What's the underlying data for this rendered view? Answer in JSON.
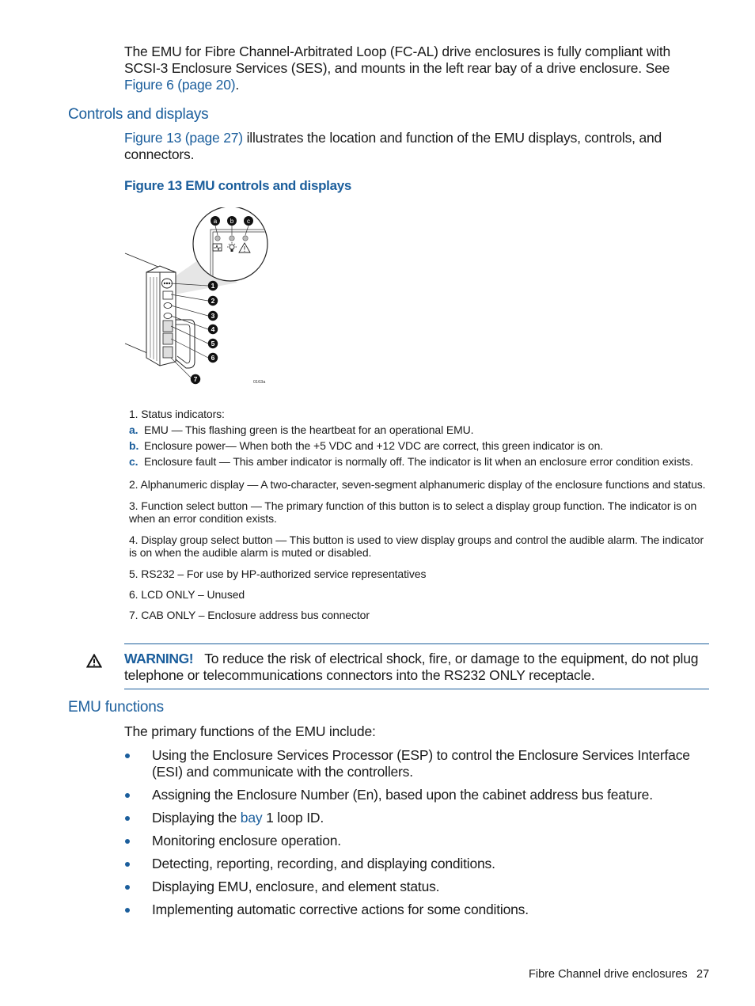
{
  "intro": {
    "text_before_link": "The EMU for Fibre Channel-Arbitrated Loop (FC-AL) drive enclosures is fully compliant with SCSI-3 Enclosure Services (SES), and mounts in the left rear bay of a drive enclosure. See ",
    "link": "Figure 6 (page 20)",
    "text_after_link": "."
  },
  "controls_section": {
    "heading": "Controls and displays",
    "para_link": "Figure 13 (page 27)",
    "para_text": " illustrates the location and function of the EMU displays, controls, and connectors.",
    "figure_title": "Figure 13 EMU controls and displays",
    "figure": {
      "inset_labels": [
        "a",
        "b",
        "c"
      ],
      "inset_icons": [
        "heartbeat-icon",
        "power-sun-icon",
        "warning-triangle-icon"
      ],
      "callouts": [
        "1",
        "2",
        "3",
        "4",
        "5",
        "6",
        "7"
      ],
      "figure_id": "0163a"
    },
    "legend": {
      "item1": "1. Status indicators:",
      "sub_items": [
        {
          "label": "a.",
          "text": "EMU — This flashing green is the heartbeat for an operational EMU."
        },
        {
          "label": "b.",
          "text": "Enclosure power— When both the +5 VDC and +12 VDC are correct, this green indicator is on."
        },
        {
          "label": "c.",
          "text": "Enclosure fault — This amber indicator is normally off. The indicator is lit when an enclosure error condition exists."
        }
      ],
      "items": [
        "2. Alphanumeric display — A two-character, seven-segment alphanumeric display of the enclosure functions and status.",
        "3. Function select button — The primary function of this button is to select a display group function. The indicator is on when an error condition exists.",
        "4. Display group select button — This button is used to view display groups and control the audible alarm. The indicator is on when the audible alarm is muted or disabled.",
        "5. RS232 – For use by HP-authorized service representatives",
        "6. LCD ONLY – Unused",
        "7. CAB ONLY – Enclosure address bus connector"
      ]
    }
  },
  "warning": {
    "icon": "warning-triangle-icon",
    "label": "WARNING!",
    "text": "To reduce the risk of electrical shock, fire, or damage to the equipment, do not plug telephone or telecommunications connectors into the RS232 ONLY receptacle."
  },
  "functions_section": {
    "heading": "EMU functions",
    "intro": "The primary functions of the EMU include:",
    "bullets": [
      {
        "text": "Using the Enclosure Services Processor (ESP) to control the Enclosure Services Interface (ESI) and communicate with the controllers."
      },
      {
        "text": "Assigning the Enclosure Number (En), based upon the cabinet address bus feature."
      },
      {
        "before": "Displaying the ",
        "link": "bay",
        "after": " 1 loop ID."
      },
      {
        "text": "Monitoring enclosure operation."
      },
      {
        "text": "Detecting, reporting, recording, and displaying conditions."
      },
      {
        "text": "Displaying EMU, enclosure, and element status."
      },
      {
        "text": "Implementing automatic corrective actions for some conditions."
      }
    ]
  },
  "footer": {
    "section": "Fibre Channel drive enclosures",
    "page": "27"
  },
  "colors": {
    "accent": "#1b5e9c",
    "text": "#1a1a1a"
  }
}
